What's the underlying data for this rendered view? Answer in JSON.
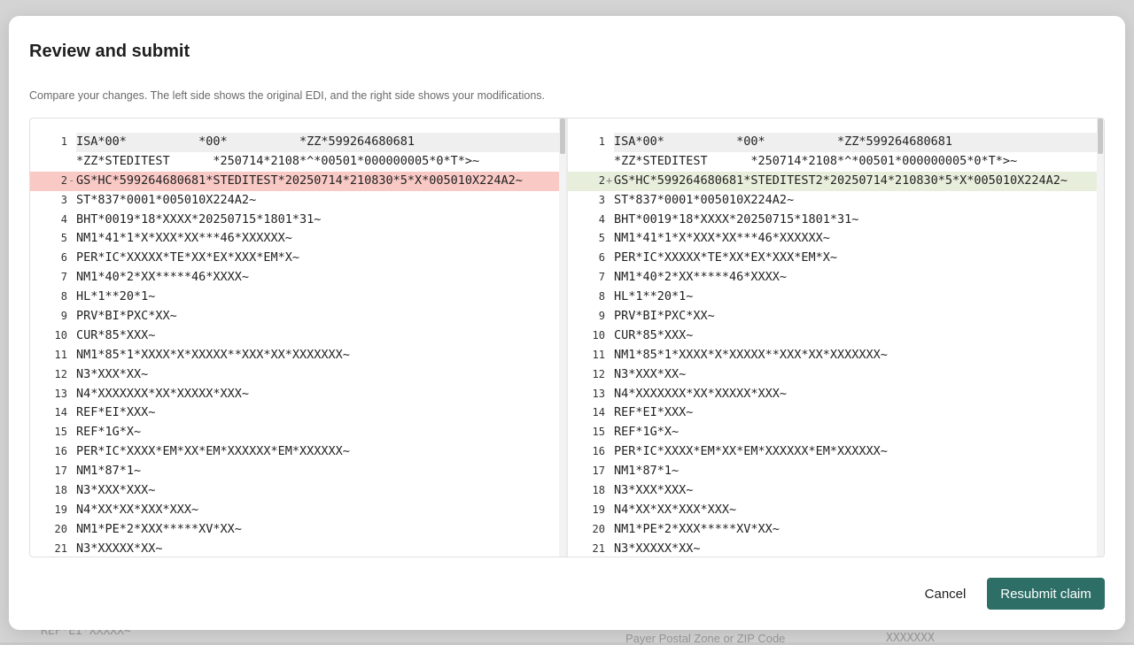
{
  "modal": {
    "title": "Review and submit",
    "description": "Compare your changes. The left side shows the original EDI, and the right side shows your modifications.",
    "cancel_label": "Cancel",
    "submit_label": "Resubmit claim"
  },
  "colors": {
    "primary_button": "#2d6e66",
    "removed_line": "#f9c9c6",
    "added_line": "#e7efdc"
  },
  "backdrop": {
    "row_left": "REF*EI*XXXXX~",
    "row_mid": "Payer Postal Zone or ZIP Code",
    "row_right": "XXXXXXX"
  },
  "diff": {
    "left": [
      {
        "num": "1",
        "marker": "",
        "code": "ISA*00*          *00*          *ZZ*599264680681"
      },
      {
        "num": "",
        "marker": "",
        "code": "*ZZ*STEDITEST      *250714*2108*^*00501*000000005*0*T*>~"
      },
      {
        "num": "2",
        "marker": "-",
        "code": "GS*HC*599264680681*STEDITEST*20250714*210830*5*X*005010X224A2~"
      },
      {
        "num": "3",
        "marker": "",
        "code": "ST*837*0001*005010X224A2~"
      },
      {
        "num": "4",
        "marker": "",
        "code": "BHT*0019*18*XXXX*20250715*1801*31~"
      },
      {
        "num": "5",
        "marker": "",
        "code": "NM1*41*1*X*XXX*XX***46*XXXXXX~"
      },
      {
        "num": "6",
        "marker": "",
        "code": "PER*IC*XXXXX*TE*XX*EX*XXX*EM*X~"
      },
      {
        "num": "7",
        "marker": "",
        "code": "NM1*40*2*XX*****46*XXXX~"
      },
      {
        "num": "8",
        "marker": "",
        "code": "HL*1**20*1~"
      },
      {
        "num": "9",
        "marker": "",
        "code": "PRV*BI*PXC*XX~"
      },
      {
        "num": "10",
        "marker": "",
        "code": "CUR*85*XXX~"
      },
      {
        "num": "11",
        "marker": "",
        "code": "NM1*85*1*XXXX*X*XXXXX**XXX*XX*XXXXXXX~"
      },
      {
        "num": "12",
        "marker": "",
        "code": "N3*XXX*XX~"
      },
      {
        "num": "13",
        "marker": "",
        "code": "N4*XXXXXXX*XX*XXXXX*XXX~"
      },
      {
        "num": "14",
        "marker": "",
        "code": "REF*EI*XXX~"
      },
      {
        "num": "15",
        "marker": "",
        "code": "REF*1G*X~"
      },
      {
        "num": "16",
        "marker": "",
        "code": "PER*IC*XXXX*EM*XX*EM*XXXXXX*EM*XXXXXX~"
      },
      {
        "num": "17",
        "marker": "",
        "code": "NM1*87*1~"
      },
      {
        "num": "18",
        "marker": "",
        "code": "N3*XXX*XXX~"
      },
      {
        "num": "19",
        "marker": "",
        "code": "N4*XX*XX*XXX*XXX~"
      },
      {
        "num": "20",
        "marker": "",
        "code": "NM1*PE*2*XXX*****XV*XX~"
      },
      {
        "num": "21",
        "marker": "",
        "code": "N3*XXXXX*XX~"
      }
    ],
    "right": [
      {
        "num": "1",
        "marker": "",
        "code": "ISA*00*          *00*          *ZZ*599264680681"
      },
      {
        "num": "",
        "marker": "",
        "code": "*ZZ*STEDITEST      *250714*2108*^*00501*000000005*0*T*>~"
      },
      {
        "num": "2",
        "marker": "+",
        "code": "GS*HC*599264680681*STEDITEST2*20250714*210830*5*X*005010X224A2~"
      },
      {
        "num": "3",
        "marker": "",
        "code": "ST*837*0001*005010X224A2~"
      },
      {
        "num": "4",
        "marker": "",
        "code": "BHT*0019*18*XXXX*20250715*1801*31~"
      },
      {
        "num": "5",
        "marker": "",
        "code": "NM1*41*1*X*XXX*XX***46*XXXXXX~"
      },
      {
        "num": "6",
        "marker": "",
        "code": "PER*IC*XXXXX*TE*XX*EX*XXX*EM*X~"
      },
      {
        "num": "7",
        "marker": "",
        "code": "NM1*40*2*XX*****46*XXXX~"
      },
      {
        "num": "8",
        "marker": "",
        "code": "HL*1**20*1~"
      },
      {
        "num": "9",
        "marker": "",
        "code": "PRV*BI*PXC*XX~"
      },
      {
        "num": "10",
        "marker": "",
        "code": "CUR*85*XXX~"
      },
      {
        "num": "11",
        "marker": "",
        "code": "NM1*85*1*XXXX*X*XXXXX**XXX*XX*XXXXXXX~"
      },
      {
        "num": "12",
        "marker": "",
        "code": "N3*XXX*XX~"
      },
      {
        "num": "13",
        "marker": "",
        "code": "N4*XXXXXXX*XX*XXXXX*XXX~"
      },
      {
        "num": "14",
        "marker": "",
        "code": "REF*EI*XXX~"
      },
      {
        "num": "15",
        "marker": "",
        "code": "REF*1G*X~"
      },
      {
        "num": "16",
        "marker": "",
        "code": "PER*IC*XXXX*EM*XX*EM*XXXXXX*EM*XXXXXX~"
      },
      {
        "num": "17",
        "marker": "",
        "code": "NM1*87*1~"
      },
      {
        "num": "18",
        "marker": "",
        "code": "N3*XXX*XXX~"
      },
      {
        "num": "19",
        "marker": "",
        "code": "N4*XX*XX*XXX*XXX~"
      },
      {
        "num": "20",
        "marker": "",
        "code": "NM1*PE*2*XXX*****XV*XX~"
      },
      {
        "num": "21",
        "marker": "",
        "code": "N3*XXXXX*XX~"
      }
    ]
  }
}
